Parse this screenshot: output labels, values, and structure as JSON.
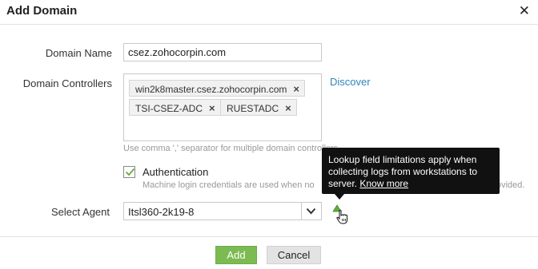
{
  "dialog": {
    "title": "Add Domain",
    "close_glyph": "✕"
  },
  "form": {
    "domain_name": {
      "label": "Domain Name",
      "value": "csez.zohocorpin.com"
    },
    "domain_controllers": {
      "label": "Domain Controllers",
      "tags": [
        {
          "text": "win2k8master.csez.zohocorpin.com",
          "remove": "×"
        },
        {
          "text": "TSI-CSEZ-ADC",
          "remove": "×"
        },
        {
          "text": "RUESTADC",
          "remove": "×"
        }
      ],
      "discover_link": "Discover",
      "hint": "Use comma ',' separator for multiple domain controllers"
    },
    "authentication": {
      "label": "Authentication",
      "checked": true,
      "note": "Machine login credentials are used when no",
      "note_tail": "ovided."
    },
    "select_agent": {
      "label": "Select Agent",
      "value": "Itsl360-2k19-8"
    }
  },
  "tooltip": {
    "text": "Lookup field limitations apply when collecting logs from workstations to server.",
    "link": "Know more"
  },
  "buttons": {
    "add": "Add",
    "cancel": "Cancel"
  },
  "colors": {
    "accent_green": "#7cbb52",
    "link_blue": "#2f86b8",
    "tooltip_bg": "#111111"
  },
  "icons": {
    "close": "close-icon",
    "remove_tag": "remove-tag-icon",
    "checkbox": "check-icon",
    "dropdown": "chevron-down-icon",
    "info": "info-icon",
    "cursor": "hand-cursor-icon"
  }
}
